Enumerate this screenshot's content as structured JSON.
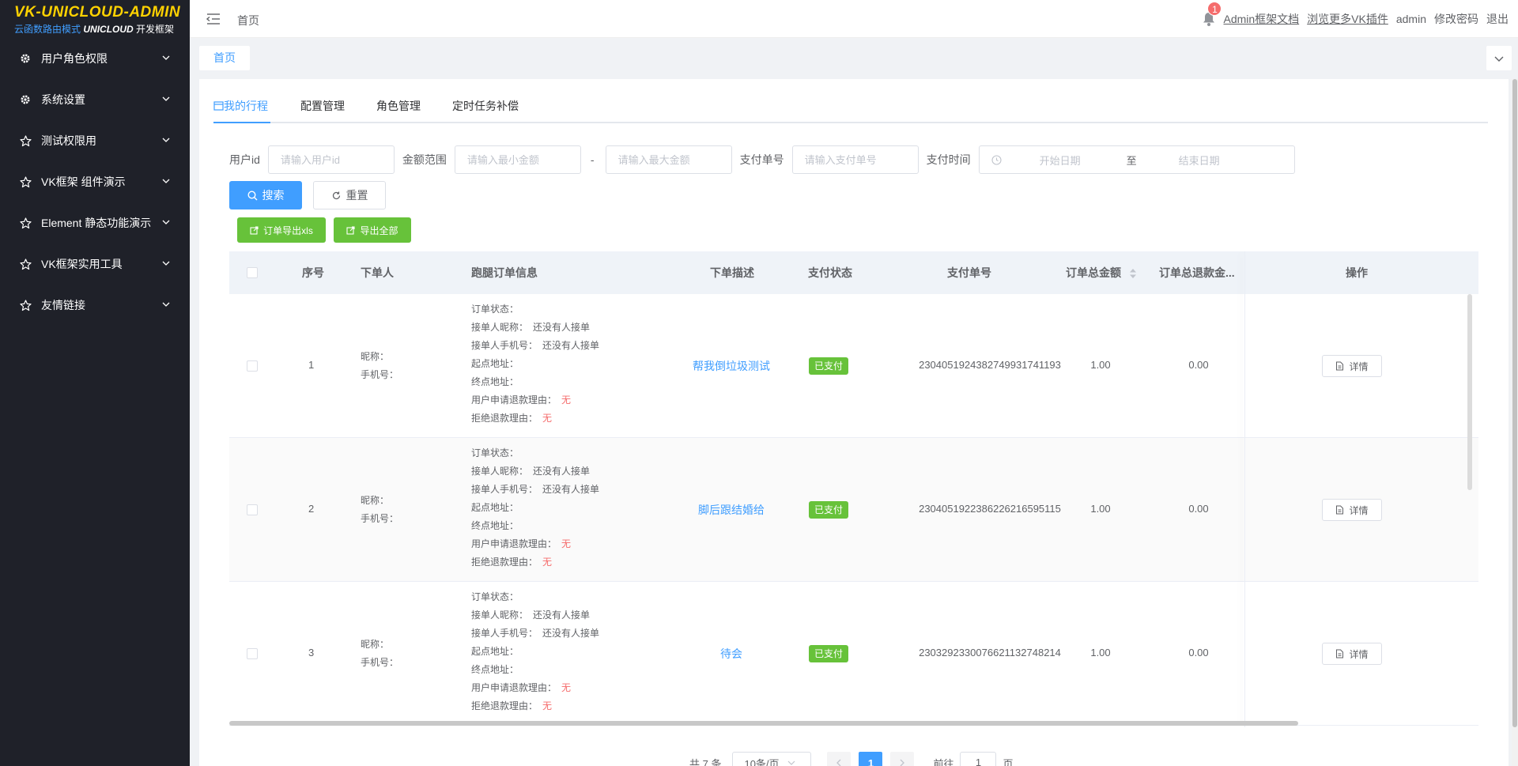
{
  "logo": {
    "title": "VK-UNICLOUD-ADMIN",
    "sub_prefix": "云函数路由模式",
    "sub_brand": "UNICLOUD",
    "sub_suffix": "开发框架"
  },
  "sidebar": {
    "items": [
      {
        "label": "用户角色权限",
        "icon": "gear-icon"
      },
      {
        "label": "系统设置",
        "icon": "gear-icon"
      },
      {
        "label": "测试权限用",
        "icon": "star-icon"
      },
      {
        "label": "VK框架 组件演示",
        "icon": "star-icon"
      },
      {
        "label": "Element 静态功能演示",
        "icon": "star-icon"
      },
      {
        "label": "VK框架实用工具",
        "icon": "star-icon"
      },
      {
        "label": "友情链接",
        "icon": "star-icon"
      }
    ]
  },
  "header": {
    "breadcrumb": "首页",
    "badge": "1",
    "links": [
      "Admin框架文档",
      "浏览更多VK插件"
    ],
    "user": "admin",
    "change_password": "修改密码",
    "logout": "退出"
  },
  "tags": {
    "active": "首页"
  },
  "tabs": [
    "我的行程",
    "配置管理",
    "角色管理",
    "定时任务补偿"
  ],
  "form": {
    "user_id_label": "用户id",
    "user_id_placeholder": "请输入用户id",
    "amount_label": "金额范围",
    "min_placeholder": "请输入最小金额",
    "range_sep": "-",
    "max_placeholder": "请输入最大金额",
    "pay_no_label": "支付单号",
    "pay_no_placeholder": "请输入支付单号",
    "pay_time_label": "支付时间",
    "start_placeholder": "开始日期",
    "range_to": "至",
    "end_placeholder": "结束日期",
    "search": "搜索",
    "reset": "重置",
    "export_xls": "订单导出xls",
    "export_all": "导出全部"
  },
  "table": {
    "headers": {
      "index": "序号",
      "orderer": "下单人",
      "info": "跑腿订单信息",
      "desc": "下单描述",
      "pay_status": "支付状态",
      "pay_no": "支付单号",
      "total": "订单总金额",
      "refund": "订单总退款金...",
      "action": "操作"
    },
    "labels": {
      "nickname": "昵称：",
      "phone": "手机号：",
      "order_status": "订单状态：",
      "taker_nick": "接单人昵称：",
      "taker_phone": "接单人手机号：",
      "start_addr": "起点地址：",
      "end_addr": "终点地址：",
      "refund_reason": "用户申请退款理由：",
      "reject_reason": "拒绝退款理由：",
      "detail": "详情"
    },
    "rows": [
      {
        "index": "1",
        "taker_nick": "还没有人接单",
        "taker_phone": "还没有人接单",
        "refund_reason": "无",
        "reject_reason": "无",
        "desc": "帮我倒垃圾测试",
        "pay_status": "已支付",
        "pay_no": "2304051924382749931741193",
        "total": "1.00",
        "refund": "0.00"
      },
      {
        "index": "2",
        "taker_nick": "还没有人接单",
        "taker_phone": "还没有人接单",
        "refund_reason": "无",
        "reject_reason": "无",
        "desc": "脚后跟结婚给",
        "pay_status": "已支付",
        "pay_no": "2304051922386226216595115",
        "total": "1.00",
        "refund": "0.00"
      },
      {
        "index": "3",
        "taker_nick": "还没有人接单",
        "taker_phone": "还没有人接单",
        "refund_reason": "无",
        "reject_reason": "无",
        "desc": "待会",
        "pay_status": "已支付",
        "pay_no": "2303292330076621132748214",
        "total": "1.00",
        "refund": "0.00"
      }
    ]
  },
  "pager": {
    "total": "共 7 条",
    "page_size": "10条/页",
    "current": "1",
    "goto_label": "前往",
    "goto_value": "1",
    "page_unit": "页"
  },
  "colors": {
    "accent": "#409eff",
    "success": "#67c23a",
    "danger": "#f56c6c",
    "sidebar_bg": "#1f2129",
    "logo": "#ffd200"
  }
}
